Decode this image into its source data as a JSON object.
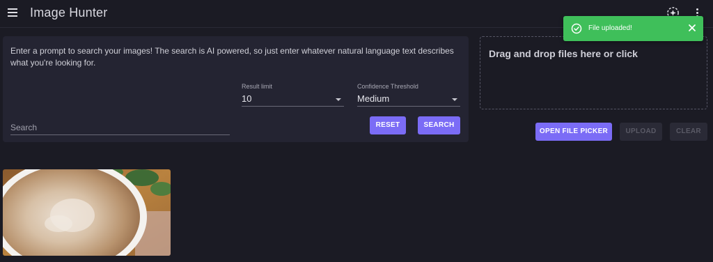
{
  "appbar": {
    "title": "Image Hunter",
    "menu_icon": "hamburger-menu-icon",
    "ai_icon": "sparkle-plus-icon",
    "more_icon": "vertical-dots-icon"
  },
  "search": {
    "prompt": "Enter a prompt to search your images! The search is AI powered, so just enter whatever natural language text describes what you're looking for.",
    "search_placeholder": "Search",
    "result_limit_label": "Result limit",
    "result_limit_value": "10",
    "confidence_label": "Confidence Threshold",
    "confidence_value": "Medium",
    "reset_label": "RESET",
    "search_label": "SEARCH"
  },
  "upload": {
    "dropzone_text": "Drag and drop files here or click",
    "open_picker_label": "OPEN FILE PICKER",
    "upload_label": "UPLOAD",
    "clear_label": "CLEAR"
  },
  "toast": {
    "message": "File uploaded!",
    "icon": "check-circle-icon",
    "close_icon": "close-icon"
  },
  "results": {
    "image_subject": "latte-art-coffee-cup"
  },
  "colors": {
    "background": "#1b1b24",
    "card": "#242432",
    "accent": "#7b6cf6",
    "success": "#3fbf5a"
  }
}
